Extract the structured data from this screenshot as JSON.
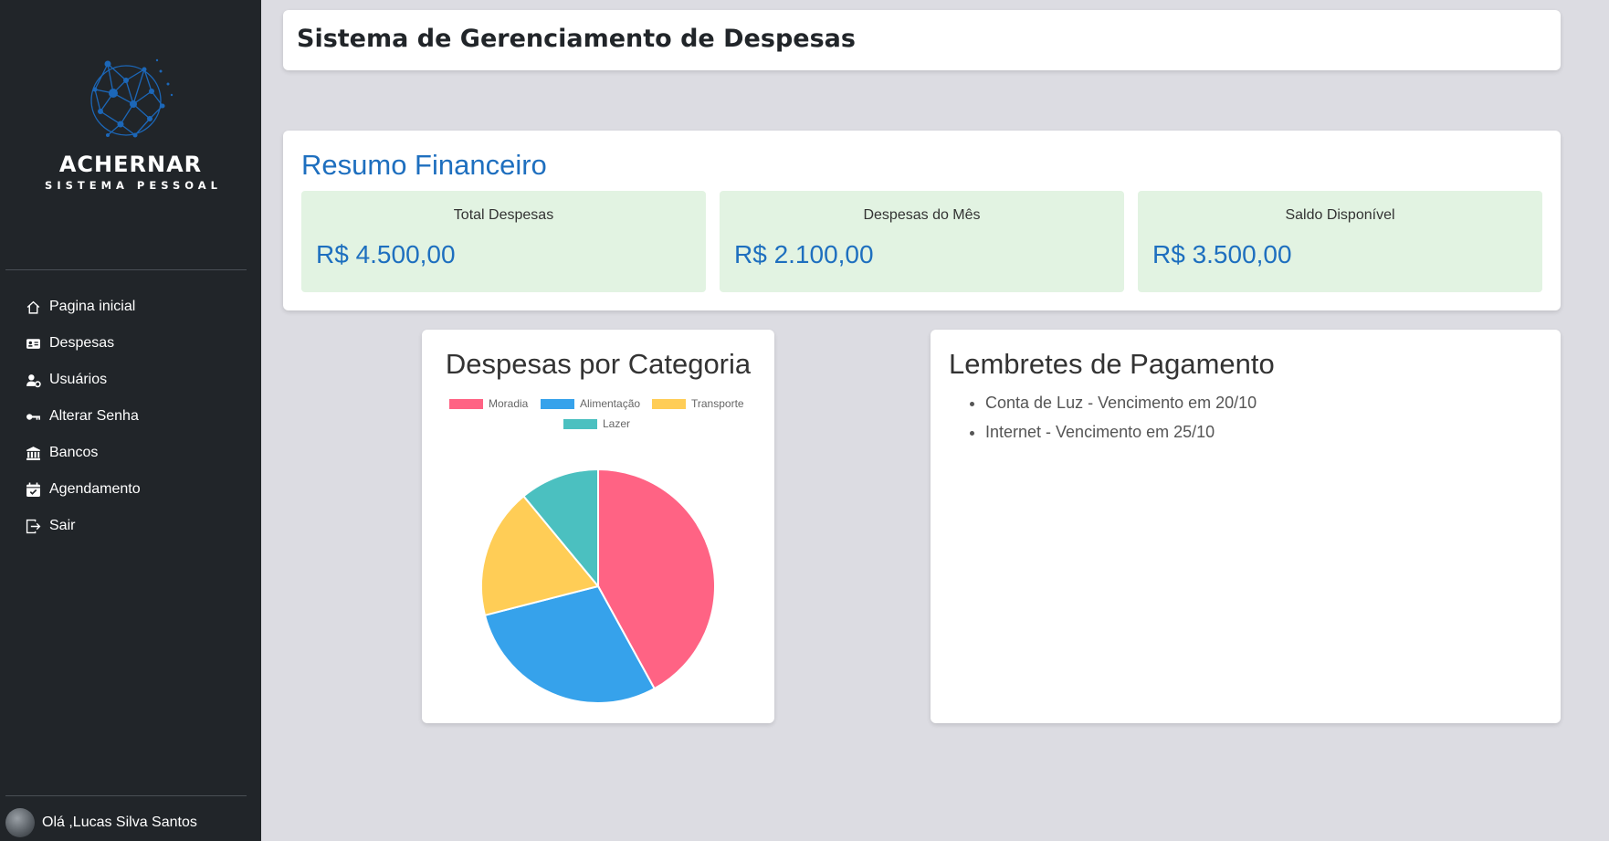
{
  "brand": {
    "name": "ACHERNAR",
    "subtitle": "SISTEMA PESSOAL"
  },
  "nav": [
    {
      "label": "Pagina inicial",
      "icon": "home-icon"
    },
    {
      "label": "Despesas",
      "icon": "id-card-icon"
    },
    {
      "label": "Usuários",
      "icon": "user-gear-icon"
    },
    {
      "label": "Alterar Senha",
      "icon": "key-icon"
    },
    {
      "label": "Bancos",
      "icon": "bank-icon"
    },
    {
      "label": "Agendamento",
      "icon": "calendar-check-icon"
    },
    {
      "label": "Sair",
      "icon": "logout-icon"
    }
  ],
  "user": {
    "greeting": "Olá ,Lucas Silva Santos"
  },
  "header": {
    "title": "Sistema de Gerenciamento de Despesas"
  },
  "summary": {
    "title": "Resumo Financeiro",
    "stats": [
      {
        "label": "Total Despesas",
        "value": "R$ 4.500,00"
      },
      {
        "label": "Despesas do Mês",
        "value": "R$ 2.100,00"
      },
      {
        "label": "Saldo Disponível",
        "value": "R$ 3.500,00"
      }
    ]
  },
  "chart": {
    "title": "Despesas por Categoria"
  },
  "chart_data": {
    "type": "pie",
    "title": "Despesas por Categoria",
    "categories": [
      "Moradia",
      "Alimentação",
      "Transporte",
      "Lazer"
    ],
    "values": [
      42,
      29,
      18,
      11
    ],
    "colors": [
      "#ff6384",
      "#36a2eb",
      "#ffcd56",
      "#4bc0c0"
    ],
    "legend": "top"
  },
  "reminders": {
    "title": "Lembretes de Pagamento",
    "items": [
      "Conta de Luz - Vencimento em 20/10",
      "Internet - Vencimento em 25/10"
    ]
  },
  "colors": {
    "sidebar": "#212529",
    "background": "#dcdce2",
    "accent": "#1e6fbf",
    "stat_background": "#e2f3e2"
  }
}
